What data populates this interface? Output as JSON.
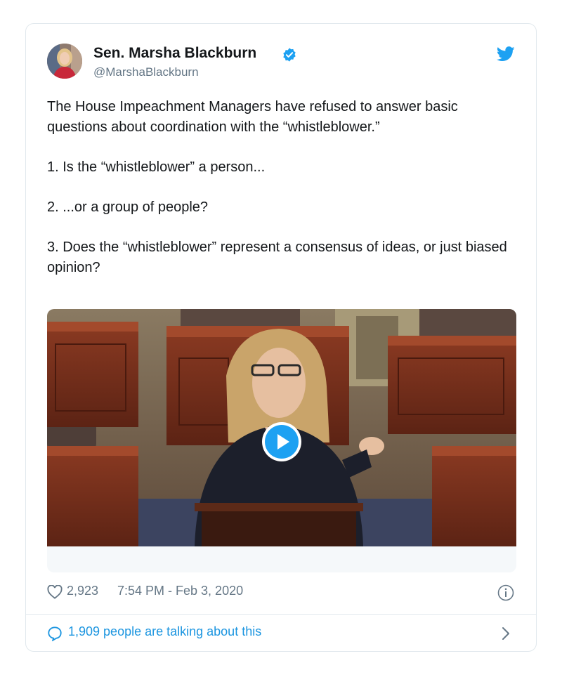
{
  "tweet": {
    "author_name": "Sen. Marsha Blackburn",
    "handle": "@MarshaBlackburn",
    "paragraphs": [
      "The House Impeachment Managers have refused to answer basic questions about coordination with the “whistleblower.”",
      "1. Is the “whistleblower” a person...",
      "2. ...or a group of people?",
      "3. Does the “whistleblower” represent a consensus of ideas, or just biased opinion?"
    ],
    "likes": "2,923",
    "timestamp": "7:54 PM - Feb 3, 2020",
    "talking": "1,909 people are talking about this"
  },
  "icons": {
    "verified": "verified-badge-icon",
    "bird": "twitter-bird-icon",
    "play": "play-icon",
    "heart": "heart-icon",
    "info": "info-icon",
    "bubble": "speech-bubble-icon",
    "chevron": "chevron-right-icon"
  },
  "colors": {
    "accent": "#1da1f2",
    "link": "#1b95e0",
    "muted": "#657786",
    "text": "#14171a",
    "border": "#e1e8ed"
  }
}
